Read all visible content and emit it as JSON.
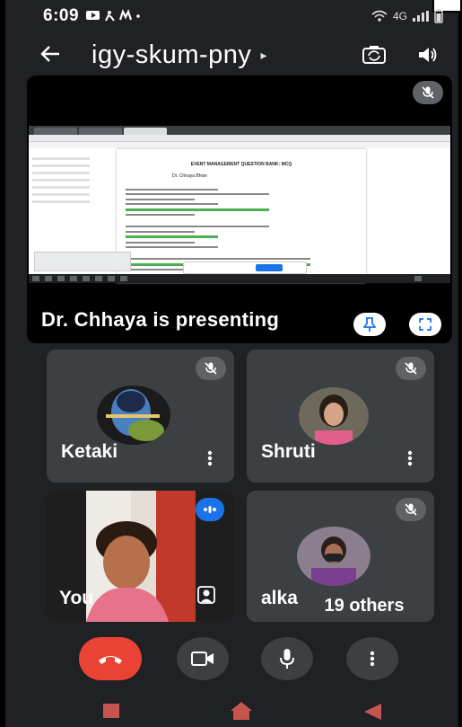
{
  "status_bar": {
    "time": "6:09",
    "network": "4G"
  },
  "header": {
    "meeting_code": "igy-skum-pny"
  },
  "presentation": {
    "label": "Dr. Chhaya is presenting",
    "doc_title": "EVENT MANAGEMENT QUESTION BANK: MCQ",
    "doc_author": "Dr. Chhaya Bhise"
  },
  "participants": [
    {
      "name": "Ketaki"
    },
    {
      "name": "Shruti"
    },
    {
      "name": "You"
    },
    {
      "name": "alka"
    }
  ],
  "others_count": "19 others",
  "colors": {
    "background": "#202124",
    "tile": "#3c4043",
    "end_call": "#ea4335",
    "accent_blue": "#1a73e8",
    "nav_red": "#d93025"
  },
  "icons": {
    "back": "arrow-left-icon",
    "switch_camera": "camera-switch-icon",
    "speaker": "speaker-icon",
    "pin": "pin-icon",
    "fullscreen": "fullscreen-icon",
    "mic_off": "mic-off-icon",
    "end_call": "phone-hangup-icon",
    "camera": "camera-icon",
    "mic": "mic-icon",
    "more": "more-vert-icon"
  }
}
